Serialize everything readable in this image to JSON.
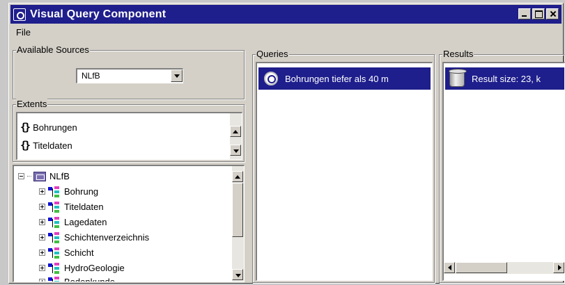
{
  "window": {
    "title": "Visual Query Component"
  },
  "menu": {
    "file": "File"
  },
  "sources": {
    "title": "Available Sources",
    "selected": "NLfB"
  },
  "extents": {
    "title": "Extents",
    "items": [
      {
        "label": "Bohrungen",
        "icon": "braces-icon"
      },
      {
        "label": "Titeldaten",
        "icon": "braces-icon"
      }
    ]
  },
  "tree": {
    "root": "NLfB",
    "items": [
      {
        "label": "Bohrung"
      },
      {
        "label": "Titeldaten"
      },
      {
        "label": "Lagedaten"
      },
      {
        "label": "Schichtenverzeichnis"
      },
      {
        "label": "Schicht"
      },
      {
        "label": "HydroGeologie"
      },
      {
        "label": "Bodenkunde"
      }
    ]
  },
  "queries": {
    "title": "Queries",
    "items": [
      {
        "label": "Bohrungen tiefer als 40 m"
      }
    ]
  },
  "results": {
    "title": "Results",
    "items": [
      {
        "label": "Result size: 23, k"
      }
    ]
  },
  "colors": {
    "titlebar": "#1e1e8c",
    "selection": "#1e1e8c",
    "face": "#d4d0c8"
  }
}
